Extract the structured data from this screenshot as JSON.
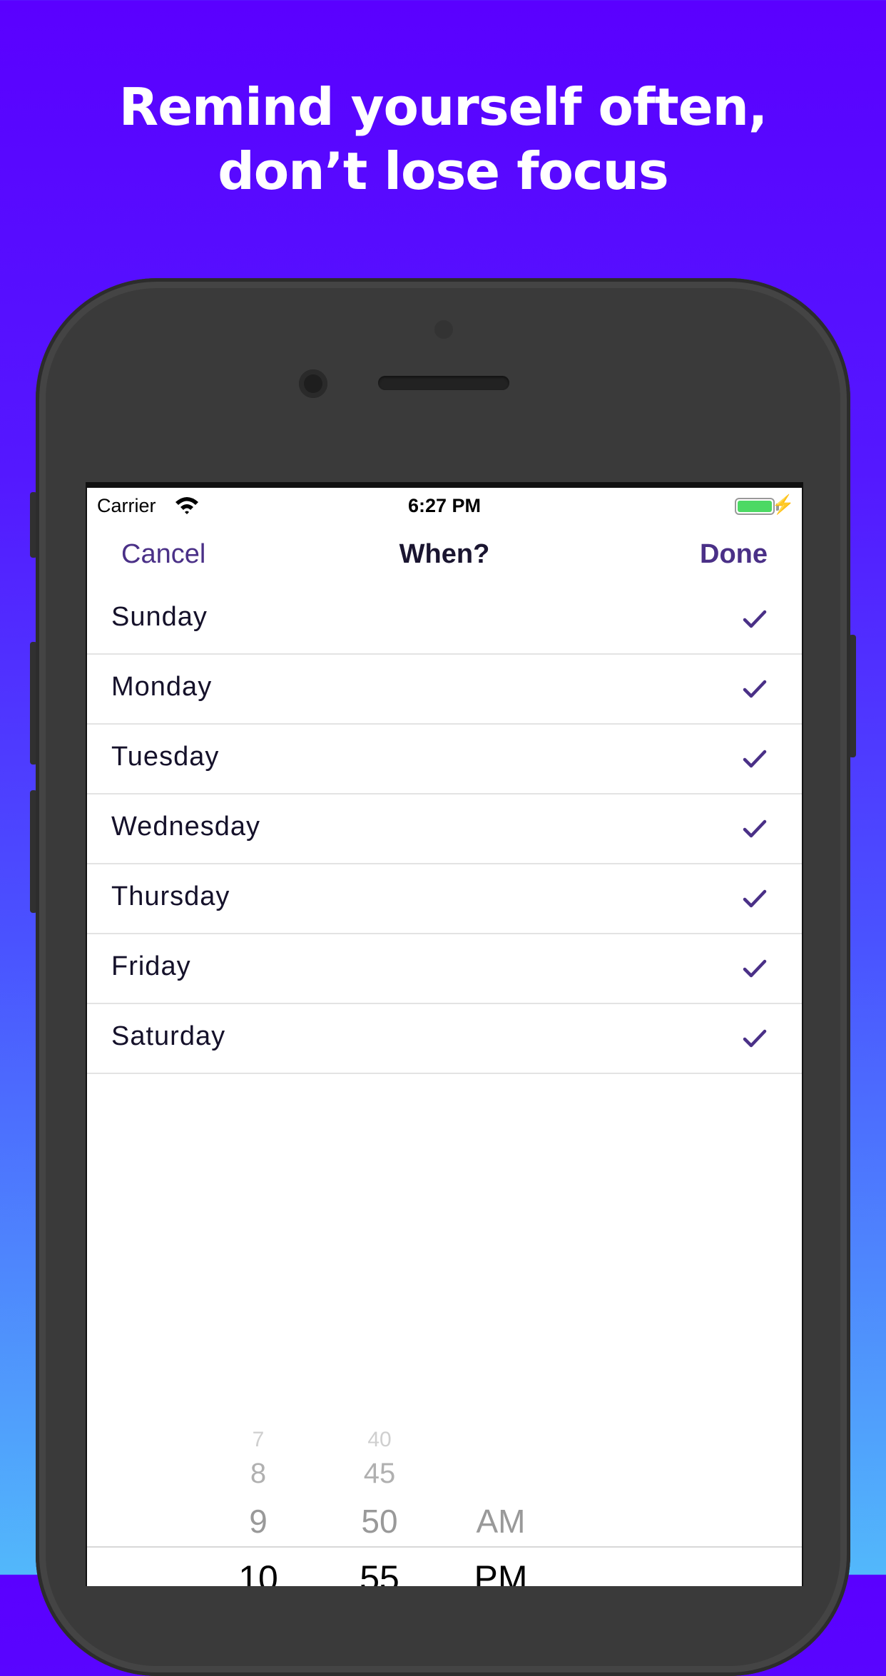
{
  "headline": {
    "line1": "Remind yourself often,",
    "line2": "don’t lose focus"
  },
  "status_bar": {
    "carrier": "Carrier",
    "time": "6:27 PM",
    "battery_color": "#4cd964"
  },
  "nav": {
    "cancel": "Cancel",
    "title": "When?",
    "done": "Done"
  },
  "days": [
    {
      "label": "Sunday",
      "checked": true
    },
    {
      "label": "Monday",
      "checked": true
    },
    {
      "label": "Tuesday",
      "checked": true
    },
    {
      "label": "Wednesday",
      "checked": true
    },
    {
      "label": "Thursday",
      "checked": true
    },
    {
      "label": "Friday",
      "checked": true
    },
    {
      "label": "Saturday",
      "checked": true
    }
  ],
  "picker": {
    "hours": [
      "7",
      "8",
      "9",
      "10"
    ],
    "minutes": [
      "40",
      "45",
      "50",
      "55"
    ],
    "periods": [
      "AM",
      "PM"
    ]
  },
  "colors": {
    "accent": "#4a3087",
    "gradient_top": "#5a00ff",
    "gradient_bottom": "#52b8fb"
  }
}
